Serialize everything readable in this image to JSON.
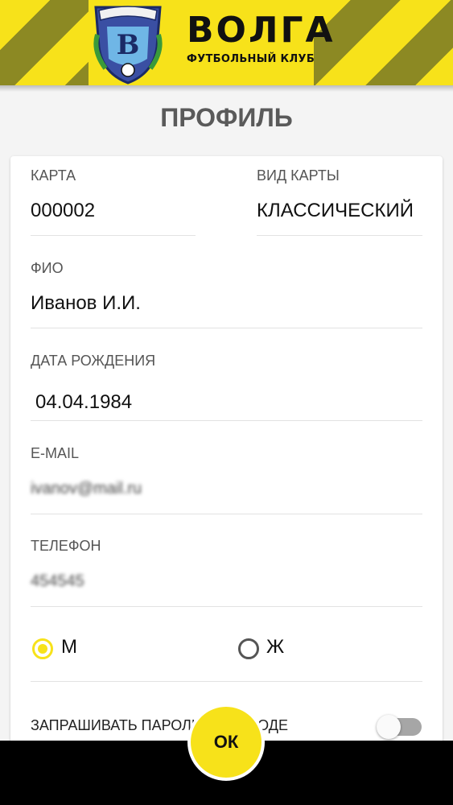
{
  "brand": {
    "title": "ВОЛГА",
    "subtitle": "ФУТБОЛЬНЫЙ КЛУБ",
    "logo_icon": "club-crest-icon",
    "colors": {
      "yellow": "#f7e21a",
      "olive": "#8c8923"
    }
  },
  "page": {
    "title": "ПРОФИЛЬ"
  },
  "form": {
    "card_label": "КАРТА",
    "card_value": "000002",
    "card_type_label": "ВИД КАРТЫ",
    "card_type_value": "КЛАССИЧЕСКИЙ",
    "name_label": "ФИО",
    "name_value": "Иванов И.И.",
    "birth_label": "ДАТА РОЖДЕНИЯ",
    "birth_value": "04.04.1984",
    "email_label": "E-MAIL",
    "email_value": "ivanov@mail.ru",
    "phone_label": "ТЕЛЕФОН",
    "phone_value": "454545",
    "gender_male_label": "М",
    "gender_female_label": "Ж",
    "gender_selected": "М",
    "ask_password_label": "ЗАПРАШИВАТЬ ПАРОЛЬ ПРИ ВХОДЕ",
    "ask_password_enabled": false
  },
  "actions": {
    "ok_label": "ОК"
  }
}
